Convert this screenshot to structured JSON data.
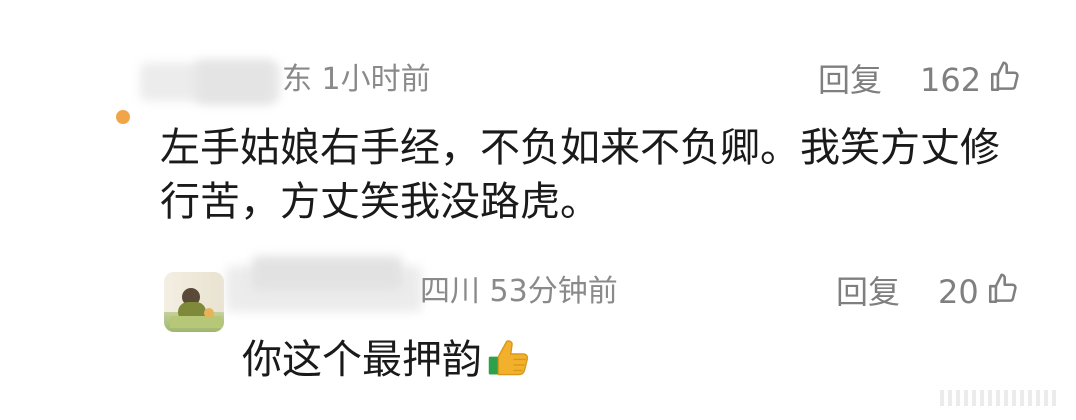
{
  "comment1": {
    "location_time_partial": "东 1小时前",
    "reply_label": "回复",
    "like_count": "162",
    "content_line1": "左手姑娘右手经，不负如来不负卿。我笑方丈修",
    "content_line2": "行苦，方丈笑我没路虎。"
  },
  "comment2": {
    "location_time": "四川 53分钟前",
    "reply_label": "回复",
    "like_count": "20",
    "content": "你这个最押韵"
  },
  "icons": {
    "thumbs_up": "thumbs-up-icon",
    "emoji": "thumbs-up-emoji"
  },
  "colors": {
    "primary_text": "#1a1a1a",
    "meta_text": "#8a8a8a",
    "accent_orange": "#f0a548",
    "emoji_thumb": "#f2b12d",
    "emoji_cuff": "#2ca14a"
  }
}
